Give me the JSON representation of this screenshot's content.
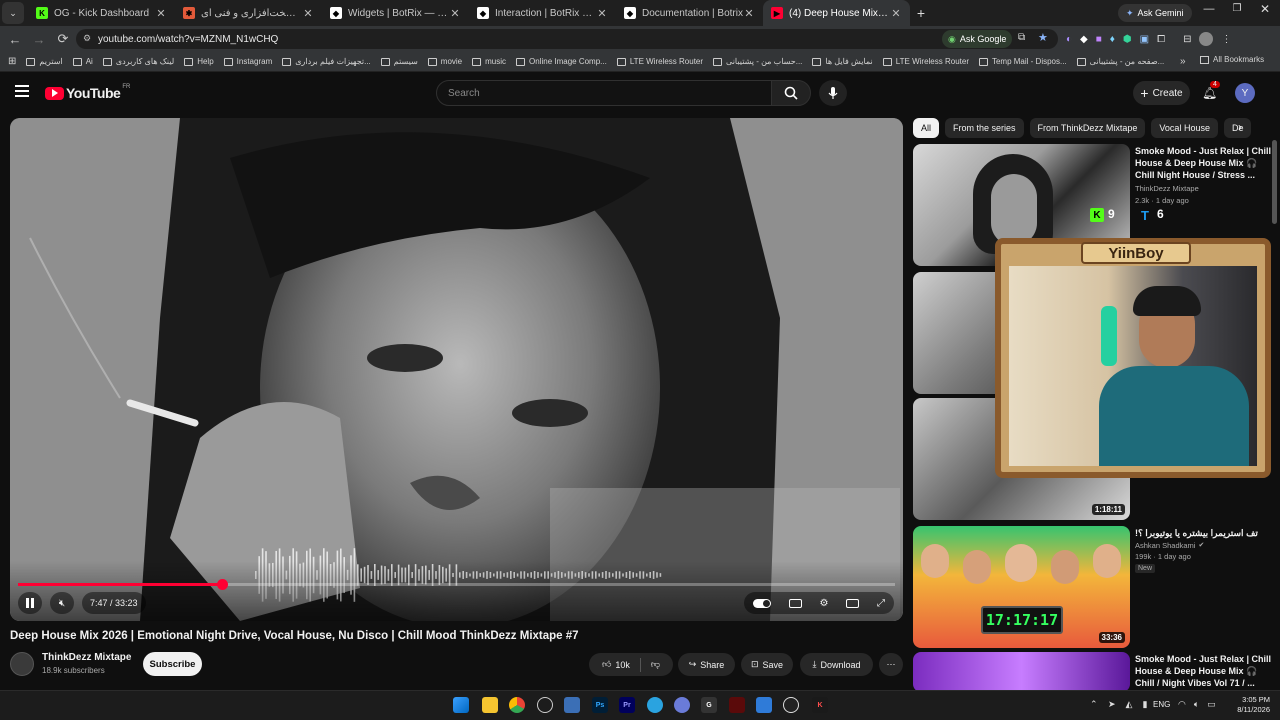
{
  "browser": {
    "tabs": [
      {
        "title": "OG - Kick Dashboard",
        "favicon_color": "#53fc18",
        "favicon_glyph": "K"
      },
      {
        "title": "حل مشکلات سخت‌افزاری و فنی ای",
        "favicon_color": "#e25a3a",
        "favicon_glyph": "✱"
      },
      {
        "title": "Widgets | BotRix — Cloud Stre",
        "favicon_color": "#ffffff",
        "favicon_glyph": "◆"
      },
      {
        "title": "Interaction | BotRix — Cloud St",
        "favicon_color": "#ffffff",
        "favicon_glyph": "◆"
      },
      {
        "title": "Documentation | Botrix",
        "favicon_color": "#ffffff",
        "favicon_glyph": "◆"
      },
      {
        "title": "(4) Deep House Mix 2026 | Emo",
        "favicon_color": "#ff0033",
        "favicon_glyph": "▶"
      }
    ],
    "ask_gemini": "Ask Gemini",
    "url": "youtube.com/watch?v=MZNM_N1wCHQ",
    "ask_google": "Ask Google",
    "bookmarks": [
      "استریم",
      "Ai",
      "لینک های کاربردی",
      "Help",
      "Instagram",
      "تجهیزات فیلم برداری...",
      "سیستم",
      "movie",
      "music",
      "Online Image Comp...",
      "LTE Wireless Router",
      "حساب من - پشتیبانی...",
      "نمایش فایل ها",
      "LTE Wireless Router",
      "Temp Mail - Dispos...",
      "صفحه من - پشتیبانی..."
    ],
    "all_bookmarks": "All Bookmarks"
  },
  "youtube": {
    "logo_text": "YouTube",
    "logo_region": "FR",
    "search_placeholder": "Search",
    "create_label": "Create",
    "notification_count": "4",
    "avatar_letter": "Y"
  },
  "player": {
    "current_time": "7:47",
    "duration": "33:23",
    "time_display": "7:47 / 33:23",
    "progress_fraction": 0.233
  },
  "video": {
    "title": "Deep House Mix 2026 | Emotional Night Drive, Vocal House, Nu Disco | Chill Mood ThinkDezz Mixtape #7",
    "channel": "ThinkDezz Mixtape",
    "subscribers": "18.9k subscribers",
    "subscribe_label": "Subscribe",
    "likes": "10k",
    "share_label": "Share",
    "save_label": "Save",
    "download_label": "Download"
  },
  "chips": [
    "All",
    "From the series",
    "From ThinkDezz Mixtape",
    "Vocal House",
    "De"
  ],
  "recommendations": [
    {
      "title": "Smoke Mood - Just Relax | Chill House & Deep House Mix 🎧 Chill Night House / Stress ...",
      "channel": "ThinkDezz Mixtape",
      "meta": "2.3k · 1 day ago"
    },
    {
      "title": "",
      "channel": "",
      "meta": "",
      "duration": "1:18:11"
    },
    {
      "title": "‏تف استریمرا بیشتره یا یوتیوبرا ؟!",
      "channel": "Ashkan Shadkami",
      "meta": "199k · 1 day ago",
      "badge": "New",
      "duration": "33:36",
      "clock": "17:17:17"
    },
    {
      "title": "Smoke Mood - Just Relax | Chill House & Deep House Mix 🎧 Chill / Night Vibes Vol 71 / ...",
      "channel": "",
      "meta": ""
    }
  ],
  "overlay": {
    "name": "YiinBoy",
    "kick_count": "9",
    "tw_count": "6"
  },
  "taskbar": {
    "lang": "ENG",
    "time": "3:05 PM",
    "date": "8/11/2026"
  }
}
